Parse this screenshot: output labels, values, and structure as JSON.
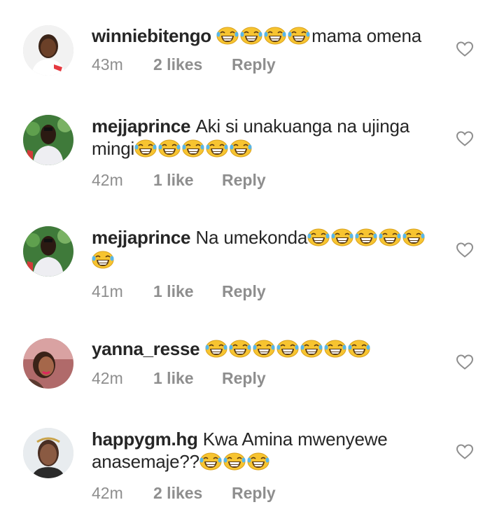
{
  "comments": [
    {
      "username": "winniebitengo",
      "text": "",
      "emojis_before_text": 4,
      "text_after_emoji": "mama omena",
      "emojis_after_text": 0,
      "time": "43m",
      "likes": "2 likes",
      "reply": "Reply"
    },
    {
      "username": "mejjaprince",
      "text": "Aki si unakuanga na ujinga mingi",
      "emojis_before_text": 0,
      "text_after_emoji": "",
      "emojis_after_text": 5,
      "time": "42m",
      "likes": "1 like",
      "reply": "Reply"
    },
    {
      "username": "mejjaprince",
      "text": "Na umekonda",
      "emojis_before_text": 0,
      "text_after_emoji": "",
      "emojis_after_text": 6,
      "time": "41m",
      "likes": "1 like",
      "reply": "Reply"
    },
    {
      "username": "yanna_resse",
      "text": "",
      "emojis_before_text": 7,
      "text_after_emoji": "",
      "emojis_after_text": 0,
      "time": "42m",
      "likes": "1 like",
      "reply": "Reply"
    },
    {
      "username": "happygm.hg",
      "text": "Kwa Amina mwenyewe anasemaje??",
      "emojis_before_text": 0,
      "text_after_emoji": "",
      "emojis_after_text": 3,
      "time": "42m",
      "likes": "2 likes",
      "reply": "Reply"
    }
  ],
  "icons": {
    "emoji": "face-with-tears-of-joy-icon",
    "like": "heart-outline-icon"
  },
  "colors": {
    "username": "#262626",
    "meta": "#8e8e8e",
    "emoji_face": "#f7c430"
  }
}
